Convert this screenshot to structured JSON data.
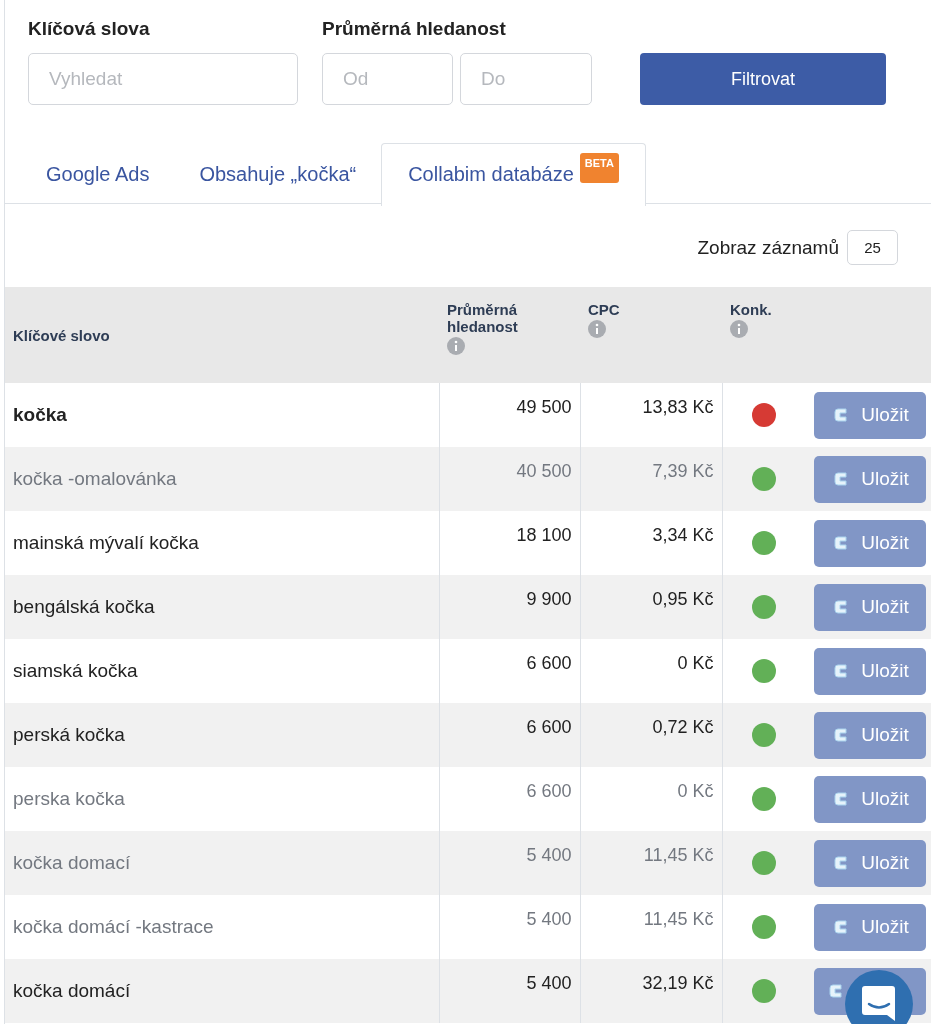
{
  "filters": {
    "keywords": {
      "label": "Klíčová slova",
      "placeholder": "Vyhledat"
    },
    "searches": {
      "label": "Průměrná hledanost",
      "from_placeholder": "Od",
      "to_placeholder": "Do"
    },
    "button": "Filtrovat"
  },
  "tabs": [
    {
      "label": "Google Ads",
      "selected": false
    },
    {
      "label": "Obsahuje „kočka“",
      "selected": false
    },
    {
      "label": "Collabim databáze",
      "badge": "BETA",
      "selected": true
    }
  ],
  "page_size": {
    "label": "Zobraz záznamů",
    "value": "25"
  },
  "table": {
    "columns": [
      "Klíčové slovo",
      "Průměrná hledanost",
      "CPC",
      "Konk."
    ],
    "rows": [
      {
        "keyword": "kočka",
        "searches": "49 500",
        "cpc": "13,83 Kč",
        "color": "#d63a34",
        "bold": true,
        "muted": false,
        "button": "Uložit"
      },
      {
        "keyword": "kočka -omalovánka",
        "searches": "40 500",
        "cpc": "7,39 Kč",
        "color": "#62b057",
        "bold": false,
        "muted": true,
        "button": "Uložit"
      },
      {
        "keyword": "mainská mývalí kočka",
        "searches": "18 100",
        "cpc": "3,34 Kč",
        "color": "#62b057",
        "bold": false,
        "muted": false,
        "button": "Uložit"
      },
      {
        "keyword": "bengálská kočka",
        "searches": "9 900",
        "cpc": "0,95 Kč",
        "color": "#62b057",
        "bold": false,
        "muted": false,
        "button": "Uložit"
      },
      {
        "keyword": "siamská kočka",
        "searches": "6 600",
        "cpc": "0 Kč",
        "color": "#62b057",
        "bold": false,
        "muted": false,
        "button": "Uložit"
      },
      {
        "keyword": "perská kočka",
        "searches": "6 600",
        "cpc": "0,72 Kč",
        "color": "#62b057",
        "bold": false,
        "muted": false,
        "button": "Uložit"
      },
      {
        "keyword": "perska kočka",
        "searches": "6 600",
        "cpc": "0 Kč",
        "color": "#62b057",
        "bold": false,
        "muted": true,
        "button": "Uložit"
      },
      {
        "keyword": "kočka domací",
        "searches": "5 400",
        "cpc": "11,45 Kč",
        "color": "#62b057",
        "bold": false,
        "muted": true,
        "button": "Uložit"
      },
      {
        "keyword": "kočka domácí -kastrace",
        "searches": "5 400",
        "cpc": "11,45 Kč",
        "color": "#62b057",
        "bold": false,
        "muted": true,
        "button": "Uložit"
      },
      {
        "keyword": "kočka domácí",
        "searches": "5 400",
        "cpc": "32,19 Kč",
        "color": "#62b057",
        "bold": false,
        "muted": false
      }
    ]
  }
}
